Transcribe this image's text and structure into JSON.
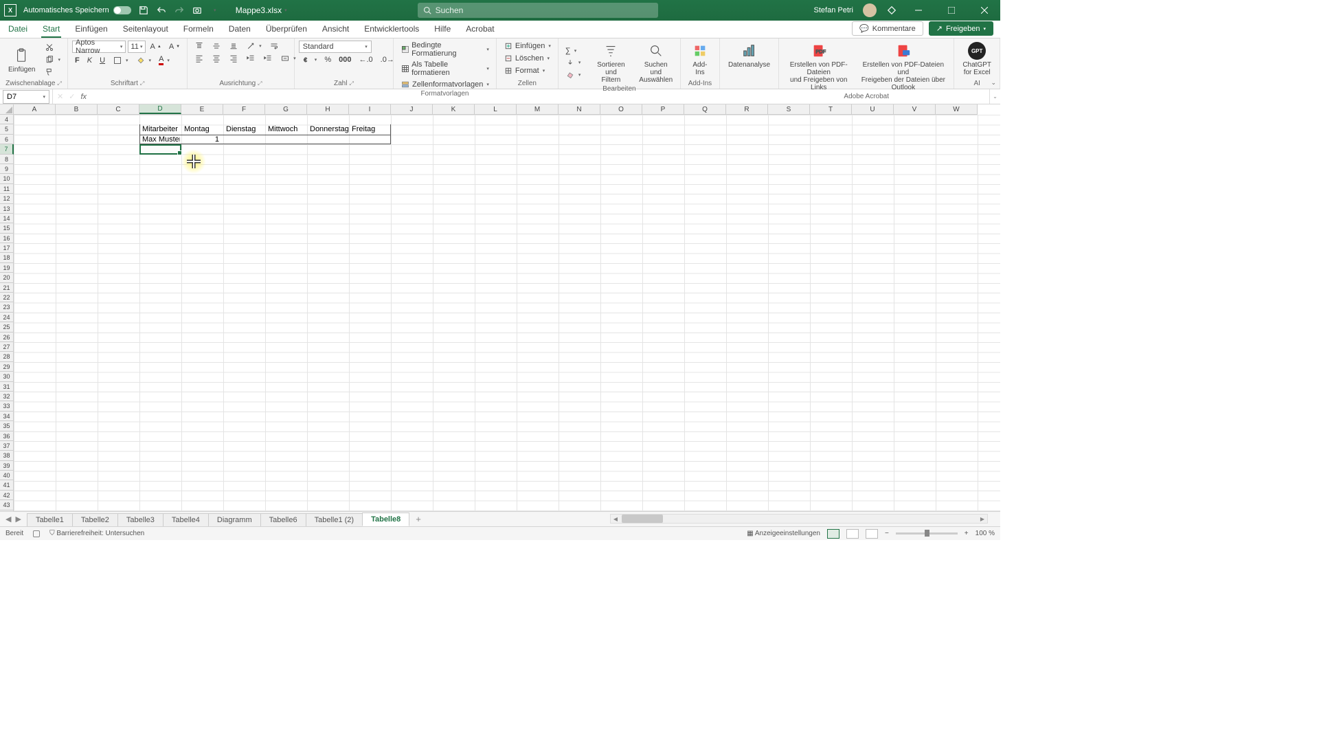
{
  "title": {
    "autosave_label": "Automatisches Speichern",
    "filename": "Mappe3.xlsx",
    "search_placeholder": "Suchen",
    "username": "Stefan Petri"
  },
  "menu": {
    "tabs": [
      "Datei",
      "Start",
      "Einfügen",
      "Seitenlayout",
      "Formeln",
      "Daten",
      "Überprüfen",
      "Ansicht",
      "Entwicklertools",
      "Hilfe",
      "Acrobat"
    ],
    "active": "Start",
    "comments": "Kommentare",
    "share": "Freigeben"
  },
  "ribbon": {
    "clipboard": {
      "paste": "Einfügen",
      "group": "Zwischenablage"
    },
    "font": {
      "name": "Aptos Narrow",
      "size": "11",
      "group": "Schriftart"
    },
    "align": {
      "group": "Ausrichtung"
    },
    "number": {
      "format": "Standard",
      "group": "Zahl"
    },
    "styles": {
      "cond": "Bedingte Formatierung",
      "table": "Als Tabelle formatieren",
      "cellstyles": "Zellenformatvorlagen",
      "group": "Formatvorlagen"
    },
    "cells": {
      "insert": "Einfügen",
      "delete": "Löschen",
      "format": "Format",
      "group": "Zellen"
    },
    "editing": {
      "sort": "Sortieren und\nFiltern",
      "find": "Suchen und\nAuswählen",
      "group": "Bearbeiten"
    },
    "addins": {
      "btn": "Add-\nIns",
      "group": "Add-Ins"
    },
    "analysis": {
      "btn": "Datenanalyse"
    },
    "acrobat": {
      "b1": "Erstellen von PDF-Dateien\nund Freigeben von Links",
      "b2": "Erstellen von PDF-Dateien und\nFreigeben der Dateien über Outlook",
      "group": "Adobe Acrobat"
    },
    "gpt": {
      "btn": "ChatGPT\nfor Excel",
      "group": "AI"
    }
  },
  "formula_bar": {
    "cellref": "D7",
    "formula": ""
  },
  "grid": {
    "columns": [
      "A",
      "B",
      "C",
      "D",
      "E",
      "F",
      "G",
      "H",
      "I",
      "J",
      "K",
      "L",
      "M",
      "N",
      "O",
      "P",
      "Q",
      "R",
      "S",
      "T",
      "U",
      "V",
      "W"
    ],
    "row_start": 4,
    "row_end": 45,
    "selected_col_index": 3,
    "selected_row": 7,
    "data": {
      "D5": "Mitarbeiter",
      "E5": "Montag",
      "F5": "Dienstag",
      "G5": "Mittwoch",
      "H5": "Donnerstag",
      "I5": "Freitag",
      "D6": "Max Mustermann",
      "E6": "1"
    }
  },
  "sheet_tabs": {
    "tabs": [
      "Tabelle1",
      "Tabelle2",
      "Tabelle3",
      "Tabelle4",
      "Diagramm",
      "Tabelle6",
      "Tabelle1 (2)",
      "Tabelle8"
    ],
    "active": "Tabelle8"
  },
  "status": {
    "ready": "Bereit",
    "accessibility": "Barrierefreiheit: Untersuchen",
    "display_settings": "Anzeigeeinstellungen",
    "zoom": "100 %"
  }
}
